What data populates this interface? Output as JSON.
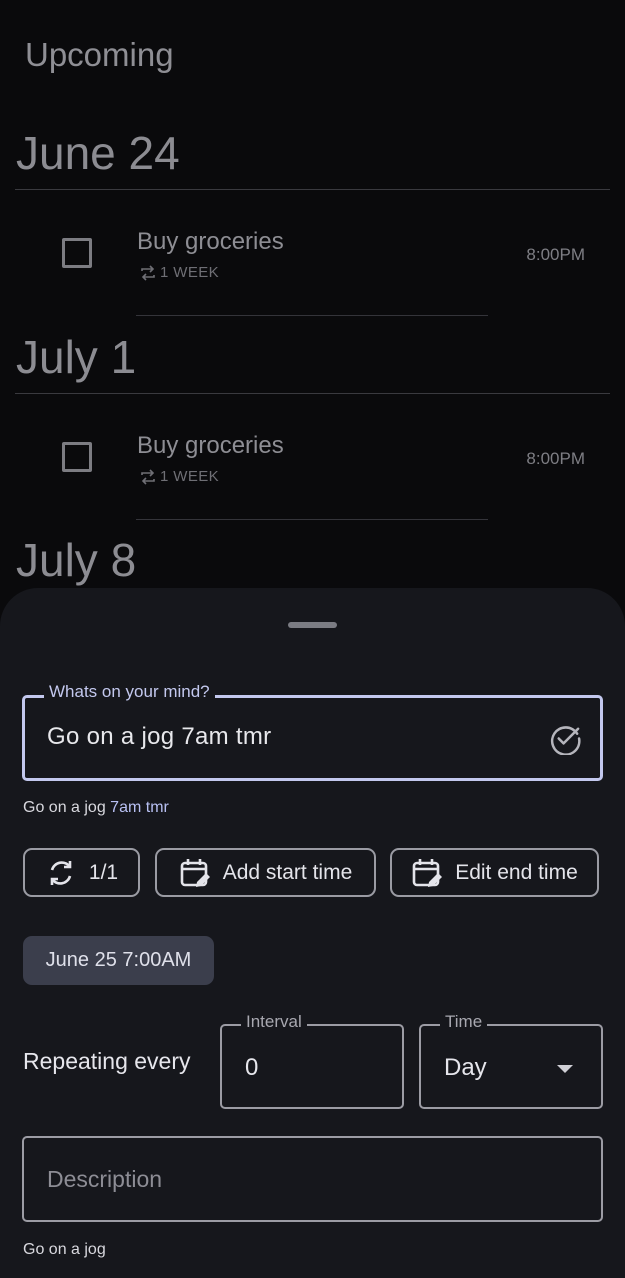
{
  "page": {
    "title": "Upcoming"
  },
  "sections": [
    {
      "date": "June 24",
      "tasks": [
        {
          "title": "Buy groceries",
          "repeat": "1 WEEK",
          "time": "8:00PM"
        }
      ]
    },
    {
      "date": "July 1",
      "tasks": [
        {
          "title": "Buy groceries",
          "repeat": "1 WEEK",
          "time": "8:00PM"
        }
      ]
    },
    {
      "date": "July 8",
      "tasks": []
    }
  ],
  "sheet": {
    "main_input": {
      "label": "Whats on your mind?",
      "value": "Go on a jog 7am tmr",
      "confirm_icon": "check-circle-icon"
    },
    "parsed_preview": {
      "plain": "Go on a jog ",
      "highlight": "7am tmr"
    },
    "chips": {
      "recurrence": {
        "label": "1/1",
        "icon": "sync-icon"
      },
      "start_time": {
        "label": "Add start time",
        "icon": "calendar-edit-icon"
      },
      "end_time": {
        "label": "Edit end time",
        "icon": "calendar-edit-icon"
      }
    },
    "selected_date": "June 25 7:00AM",
    "repeat": {
      "label": "Repeating every",
      "interval_label": "Interval",
      "interval_value": "0",
      "time_label": "Time",
      "time_value": "Day"
    },
    "description": {
      "placeholder": "Description"
    },
    "bottom_preview": "Go on a jog"
  },
  "colors": {
    "background": "#0a0a0c",
    "sheet": "#16171c",
    "accent": "#c3c8ee",
    "chip_selected": "#3b3e4c"
  }
}
